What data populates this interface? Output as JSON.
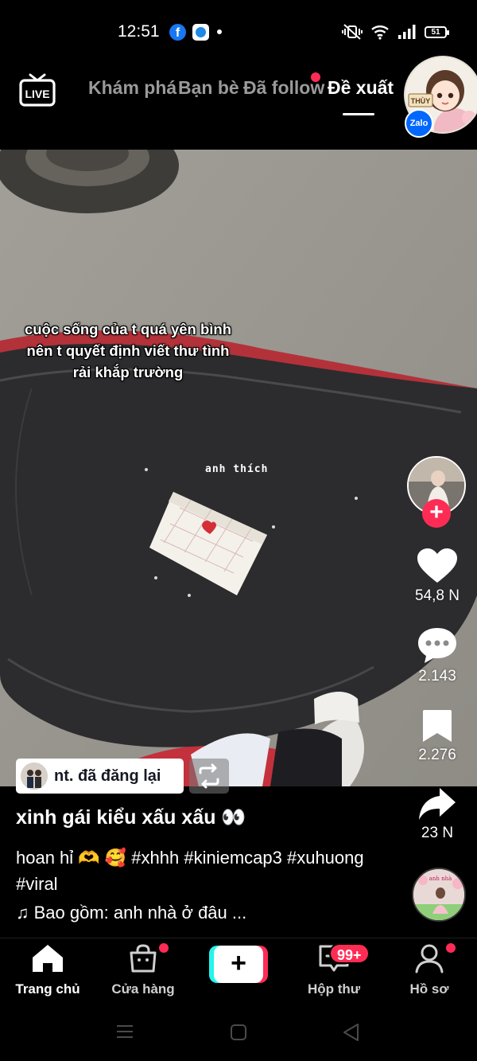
{
  "status_bar": {
    "time": "12:51",
    "battery": "51",
    "notification_icons": [
      "facebook-icon",
      "messenger-icon"
    ],
    "system_icons": [
      "mute-vibrate-icon",
      "wifi-icon",
      "signal-icon",
      "battery-icon"
    ]
  },
  "top_nav": {
    "tabs": [
      "Khám phá",
      "Bạn bè",
      "Đã follow",
      "Đề xuất"
    ],
    "active_tab": "Đề xuất",
    "profile_name_tag": "THÙY",
    "zalo_label": "Zalo"
  },
  "video": {
    "overlay_caption": "cuộc sống của t quá yên bình nên t quyết định viết thư tình rải khắp trường",
    "overlay_small_text": "anh thích"
  },
  "actions": {
    "likes": "54,8 N",
    "comments": "2.143",
    "saves": "2.276",
    "shares": "23 N"
  },
  "repost": {
    "label": "nt. đã đăng lại"
  },
  "post": {
    "title": "xinh gái kiểu xấu xấu 👀",
    "description": "hoan hỉ 🫶 🥰 #xhhh #kiniemcap3 #xuhuong #viral",
    "music": "♫ Bao gồm: anh nhà ở đâu ...",
    "disc_text": "anh nhà"
  },
  "bottom_nav": {
    "items": [
      "Trang chủ",
      "Cửa hàng",
      "",
      "Hộp thư",
      "Hồ sơ"
    ],
    "inbox_badge": "99+"
  },
  "colors": {
    "accent": "#fe2c55",
    "cyan": "#25f4ee",
    "background": "#000000"
  }
}
